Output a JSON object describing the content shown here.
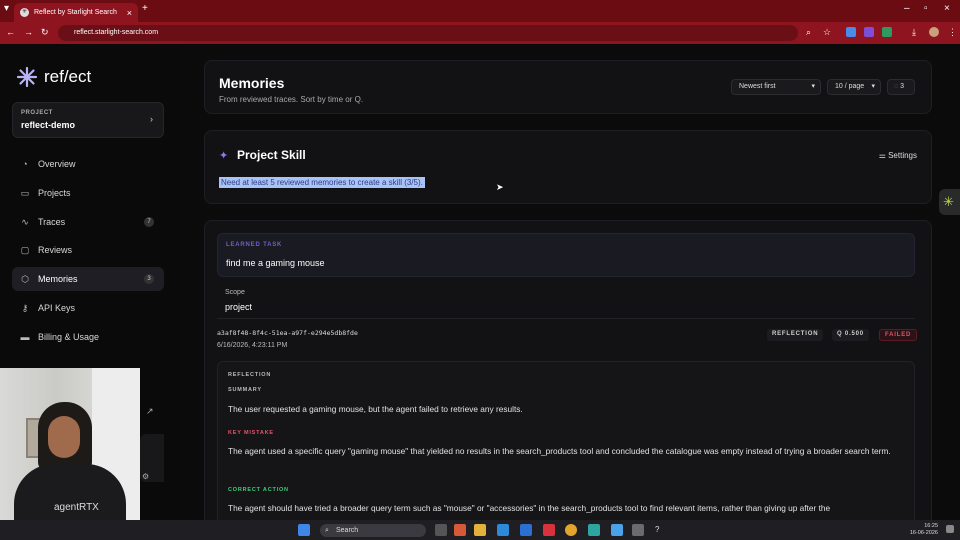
{
  "browser": {
    "tab_title": "Reflect by Starlight Search",
    "url": "reflect.starlight-search.com"
  },
  "sidebar": {
    "logo_text": "ref/ect",
    "project_label": "PROJECT",
    "project_name": "reflect-demo",
    "items": [
      {
        "label": "Overview",
        "icon": "dashboard-icon"
      },
      {
        "label": "Projects",
        "icon": "folder-icon"
      },
      {
        "label": "Traces",
        "icon": "pulse-icon",
        "badge": "7"
      },
      {
        "label": "Reviews",
        "icon": "chat-icon"
      },
      {
        "label": "Memories",
        "icon": "brain-icon",
        "badge": "3"
      },
      {
        "label": "API Keys",
        "icon": "key-icon"
      },
      {
        "label": "Billing & Usage",
        "icon": "card-icon"
      }
    ]
  },
  "header": {
    "title": "Memories",
    "subtitle": "From reviewed traces. Sort by time or Q.",
    "sort_value": "Newest first",
    "page_size_value": "10 / page",
    "count": "3"
  },
  "skill": {
    "title": "Project Skill",
    "settings_label": "Settings",
    "message": "Need at least 5 reviewed memories to create a skill (3/5)."
  },
  "memory": {
    "learned_task_label": "LEARNED TASK",
    "learned_task": "find me a gaming mouse",
    "scope_label": "Scope",
    "scope_value": "project",
    "id": "a3af8f48-8f4c-51ea-a97f-e294e5db8fde",
    "timestamp": "6/16/2026, 4:23:11 PM",
    "tags": {
      "reflection": "REFLECTION",
      "q": "Q 0.500",
      "status": "FAILED"
    },
    "reflection": {
      "header": "REFLECTION",
      "summary_label": "SUMMARY",
      "summary": "The user requested a gaming mouse, but the agent failed to retrieve any results.",
      "mistake_label": "KEY MISTAKE",
      "mistake": "The agent used a specific query \"gaming mouse\" that yielded no results in the search_products tool and concluded the catalogue was empty instead of trying a broader search term.",
      "correct_label": "CORRECT ACTION",
      "correct": "The agent should have tried a broader query term such as \"mouse\" or \"accessories\" in the search_products tool to find relevant items, rather than giving up after the"
    }
  },
  "webcam": {
    "shirt_text": "agentRTX"
  },
  "taskbar": {
    "search_placeholder": "Search",
    "time": "16:25",
    "date": "16-06-2026"
  },
  "colors": {
    "accent": "#8b7cf6",
    "failed": "#e05566",
    "highlight": "#a9c3f5"
  }
}
